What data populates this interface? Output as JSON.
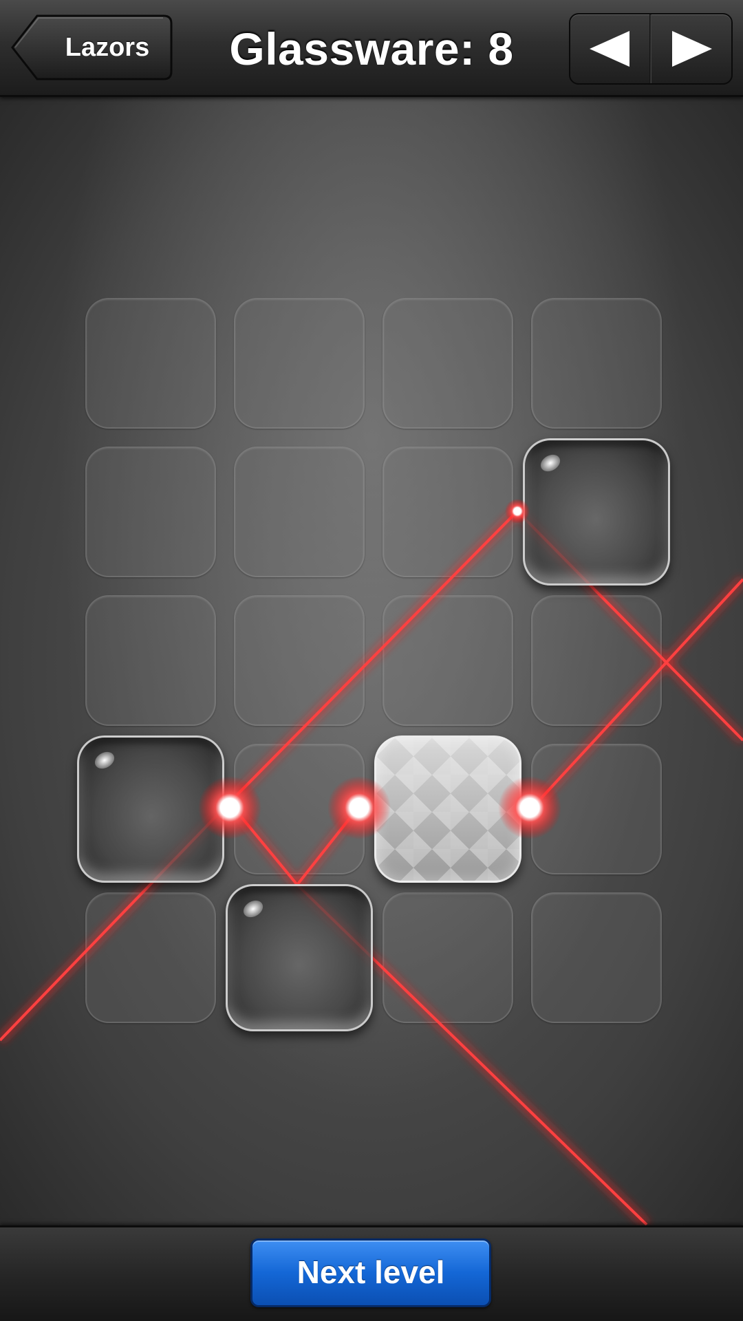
{
  "header": {
    "back_label": "Lazors",
    "level_title": "Glassware: 8",
    "prev_icon": "triangle-left-icon",
    "next_icon": "triangle-right-icon"
  },
  "board": {
    "rows": 5,
    "cols": 4,
    "blocks": [
      {
        "row": 1,
        "col": 3,
        "type": "reflect"
      },
      {
        "row": 3,
        "col": 0,
        "type": "reflect"
      },
      {
        "row": 3,
        "col": 2,
        "type": "refract"
      },
      {
        "row": 4,
        "col": 1,
        "type": "reflect"
      }
    ],
    "laser_color": "#ff1e1e"
  },
  "footer": {
    "next_level_label": "Next level"
  },
  "colors": {
    "accent_blue": "#1467d6",
    "laser_red": "#ff1e1e"
  }
}
